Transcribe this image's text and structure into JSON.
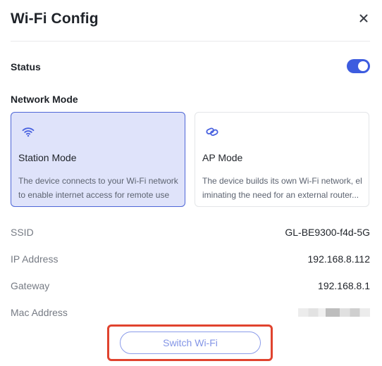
{
  "dialog": {
    "title": "Wi-Fi Config"
  },
  "status": {
    "label": "Status",
    "enabled": true
  },
  "network_mode": {
    "label": "Network Mode",
    "options": [
      {
        "title": "Station Mode",
        "description": "The device connects to your Wi-Fi network to enable internet access for remote use",
        "icon": "wifi-icon",
        "selected": true
      },
      {
        "title": "AP Mode",
        "description": "The device builds its own Wi-Fi network, eliminating the need for an external router...",
        "icon": "link-icon",
        "selected": false
      }
    ]
  },
  "info": {
    "ssid_label": "SSID",
    "ssid_value": "GL-BE9300-f4d-5G",
    "ip_label": "IP Address",
    "ip_value": "192.168.8.112",
    "gateway_label": "Gateway",
    "gateway_value": "192.168.8.1",
    "mac_label": "Mac Address"
  },
  "actions": {
    "switch_wifi_label": "Switch Wi-Fi"
  },
  "colors": {
    "accent": "#3d5cdf",
    "selected_card_bg": "#dfe3fa",
    "highlight": "#e0432e"
  }
}
